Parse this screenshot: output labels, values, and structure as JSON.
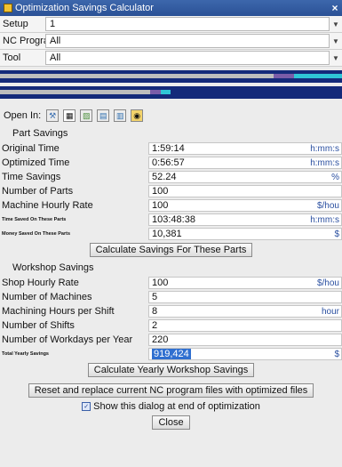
{
  "window": {
    "title": "Optimization Savings Calculator",
    "close_glyph": "×"
  },
  "selectors": [
    {
      "label": "Setup",
      "value": "1"
    },
    {
      "label": "NC Program",
      "value": "All"
    },
    {
      "label": "Tool",
      "value": "All"
    }
  ],
  "progress": [
    {
      "fill": 0.8
    },
    {
      "fill": 0.44
    }
  ],
  "open_in": {
    "label": "Open In:",
    "icons": [
      "wrench-icon",
      "grid-icon",
      "image-icon",
      "chart-icon",
      "list-icon",
      "clipboard-icon"
    ]
  },
  "part_savings": {
    "legend": "Part Savings",
    "rows": [
      {
        "label": "Original Time",
        "value": "1:59:14",
        "unit": "h:mm:s"
      },
      {
        "label": "Optimized Time",
        "value": "0:56:57",
        "unit": "h:mm:s"
      },
      {
        "label": "Time Savings",
        "value": "52.24",
        "unit": "%"
      },
      {
        "label": "Number of Parts",
        "value": "100",
        "unit": ""
      },
      {
        "label": "Machine Hourly Rate",
        "value": "100",
        "unit": "$/hou"
      },
      {
        "label": "Time Saved On These Parts",
        "value": "103:48:38",
        "unit": "h:mm:s",
        "small": true
      },
      {
        "label": "Money Saved On These Parts",
        "value": "10,381",
        "unit": "$",
        "small": true
      }
    ],
    "button": "Calculate Savings For These Parts"
  },
  "workshop_savings": {
    "legend": "Workshop Savings",
    "rows": [
      {
        "label": "Shop Hourly Rate",
        "value": "100",
        "unit": "$/hou"
      },
      {
        "label": "Number of Machines",
        "value": "5",
        "unit": ""
      },
      {
        "label": "Machining Hours per Shift",
        "value": "8",
        "unit": "hour"
      },
      {
        "label": "Number of Shifts",
        "value": "2",
        "unit": ""
      },
      {
        "label": "Number of Workdays per Year",
        "value": "220",
        "unit": ""
      },
      {
        "label": "Total Yearly Savings",
        "value": "919,424",
        "unit": "$",
        "small": true,
        "highlight": true
      }
    ],
    "button": "Calculate Yearly Workshop Savings"
  },
  "replace_button": "Reset and replace current NC program files with optimized files",
  "show_dialog": {
    "label": "Show this dialog at end of optimization",
    "checked": true
  },
  "close_button": "Close"
}
